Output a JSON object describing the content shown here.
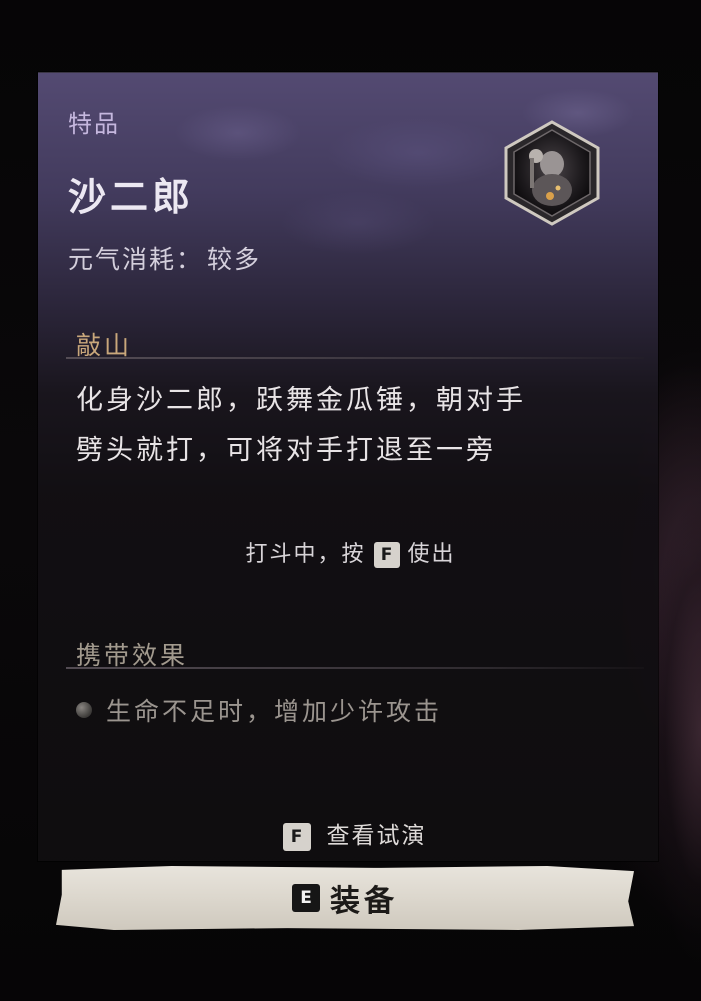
{
  "item": {
    "grade": "特品",
    "name": "沙二郎",
    "cost_label": "元气消耗：",
    "cost_value": "较多",
    "icon": "spirit-portrait-icon"
  },
  "skill": {
    "title": "敲山",
    "description_line1": "化身沙二郎，跃舞金瓜锤，朝对手",
    "description_line2": "劈头就打，可将对手打退至一旁",
    "hint_before": "打斗中，按",
    "hint_key": "F",
    "hint_after": "使出"
  },
  "carry": {
    "title": "携带效果",
    "effects": [
      "生命不足时，增加少许攻击"
    ]
  },
  "preview": {
    "key": "F",
    "label": "查看试演"
  },
  "equip": {
    "key": "E",
    "label": "装备"
  },
  "colors": {
    "grade": "#c5b7de",
    "skill_title": "#c9a77b",
    "card_top": "#584e78",
    "button": "#dcd7cd"
  }
}
